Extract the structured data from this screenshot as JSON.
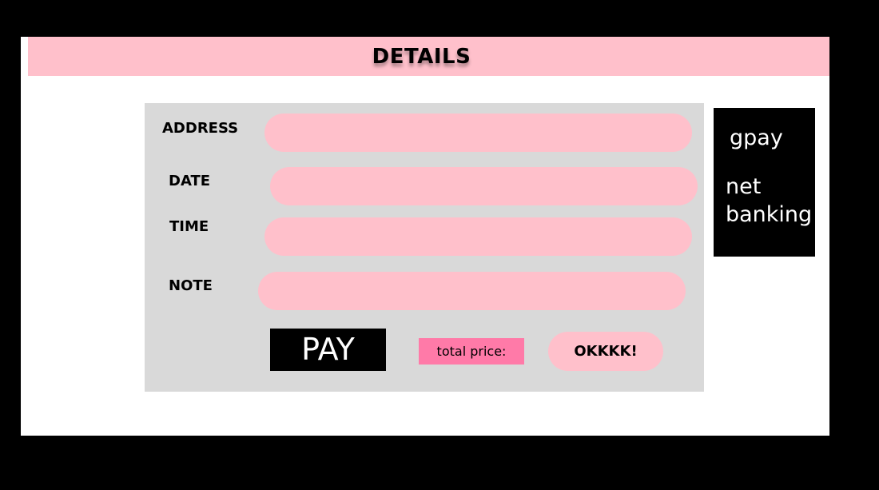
{
  "header": {
    "title": "DETAILS"
  },
  "form": {
    "fields": [
      {
        "label": "ADDRESS",
        "value": "",
        "placeholder": ""
      },
      {
        "label": "DATE",
        "value": "",
        "placeholder": ""
      },
      {
        "label": "TIME",
        "value": "",
        "placeholder": ""
      },
      {
        "label": "NOTE",
        "value": "",
        "placeholder": ""
      }
    ],
    "pay_label": "PAY",
    "total_price_label": "total price:",
    "ok_label": "OKKKK!"
  },
  "payment_options": [
    {
      "label": "gpay"
    },
    {
      "line1": "net",
      "line2": "banking"
    }
  ],
  "colors": {
    "background": "#000000",
    "frame": "#ffffff",
    "accent_pink": "#ffc0cb",
    "hot_pink": "#ff7aa8",
    "panel_gray": "#d9d9d9"
  }
}
